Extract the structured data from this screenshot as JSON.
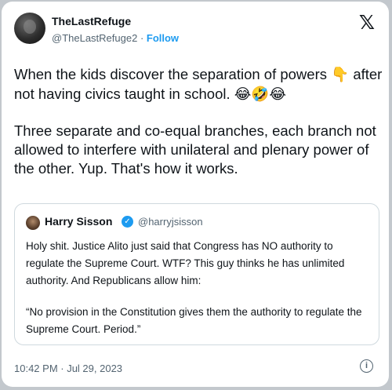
{
  "author": {
    "name": "TheLastRefuge",
    "handle": "@TheLastRefuge2",
    "separator": " · ",
    "follow_label": "Follow"
  },
  "platform_logo": "𝕏",
  "tweet": {
    "paragraph1": "When the kids discover the separation of powers",
    "paragraph1_emoji": "👇",
    "paragraph1_cont": " after not having civics taught in school.",
    "paragraph1_emojis": "😂🤣😂",
    "paragraph2": "Three separate and co-equal branches, each branch not allowed to interfere with unilateral and plenary power of the other. Yup. That's how it works."
  },
  "quoted": {
    "name": "Harry Sisson",
    "verified_mark": "✓",
    "handle": "@harryjsisson",
    "paragraph1": "Holy shit. Justice Alito just said that Congress has NO authority to regulate the Supreme Court. WTF? This guy thinks he has unlimited authority. And Republicans allow him:",
    "paragraph2": "“No provision in the Constitution gives them the authority to regulate the Supreme Court. Period.”"
  },
  "timestamp": "10:42 PM · Jul 29, 2023",
  "info_glyph": "i",
  "icons": {
    "avatar": "avatar",
    "x_logo": "x-logo-icon",
    "verified": "verified-badge-icon",
    "info": "info-icon"
  }
}
